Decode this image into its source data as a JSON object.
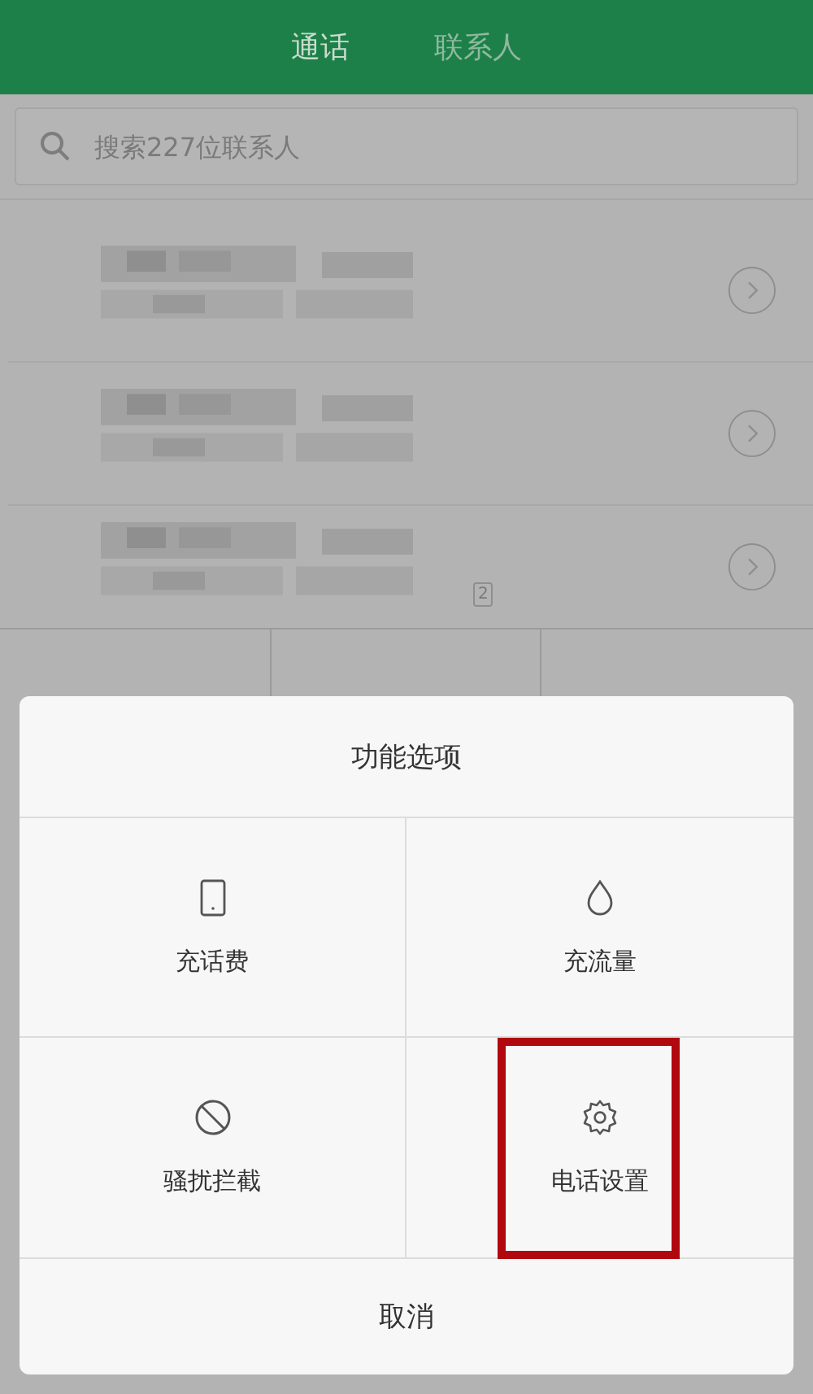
{
  "tabs": [
    {
      "label": "通话",
      "selected": true
    },
    {
      "label": "联系人",
      "selected": false
    }
  ],
  "search": {
    "placeholder": "搜索227位联系人"
  },
  "calls": [
    {
      "kind": "redacted"
    },
    {
      "kind": "redacted"
    },
    {
      "kind": "redacted",
      "badge": "2"
    }
  ],
  "dialog": {
    "title": "功能选项",
    "items": [
      {
        "label": "充话费",
        "highlighted": false
      },
      {
        "label": "充流量",
        "highlighted": false
      },
      {
        "label": "骚扰拦截",
        "highlighted": false
      },
      {
        "label": "电话设置",
        "highlighted": true
      }
    ],
    "cancel": "取消"
  }
}
